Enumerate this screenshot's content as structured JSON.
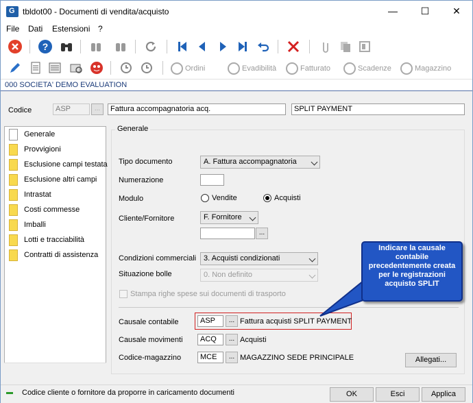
{
  "window": {
    "title": "tbldot00 - Documenti di vendita/acquisto",
    "minimize": "—",
    "maximize": "☐",
    "close": "✕"
  },
  "menu": [
    "File",
    "Dati",
    "Estensioni",
    "?"
  ],
  "toolbar2": {
    "ordini": "Ordini",
    "evadibilita": "Evadibilità",
    "fatturato": "Fatturato",
    "scadenze": "Scadenze",
    "magazzino": "Magazzino"
  },
  "company": "000 SOCIETA' DEMO EVALUATION",
  "header": {
    "codice_label": "Codice",
    "codice": "ASP",
    "descrizione": "Fattura accompagnatoria acq.",
    "descrizione2": "SPLIT PAYMENT",
    "dots": "..."
  },
  "sidebar": {
    "items": [
      "Generale",
      "Provvigioni",
      "Esclusione campi testata",
      "Esclusione altri campi",
      "Intrastat",
      "Costi commesse",
      "Imballi",
      "Lotti e tracciabilità",
      "Contratti di assistenza"
    ]
  },
  "form": {
    "group_title": "Generale",
    "tipo_documento_label": "Tipo documento",
    "tipo_documento": "A. Fattura accompagnatoria",
    "numerazione_label": "Numerazione",
    "numerazione": "",
    "modulo_label": "Modulo",
    "vendite": "Vendite",
    "acquisti": "Acquisti",
    "cliente_fornitore_label": "Cliente/Fornitore",
    "cliente_fornitore": "F. Fornitore",
    "cliente_fornitore_code": "",
    "condizioni_label": "Condizioni commerciali",
    "condizioni": "3. Acquisti condizionati",
    "situazione_label": "Situazione bolle",
    "situazione": "0. Non definito",
    "stampa_label": "Stampa righe spese sui documenti di trasporto",
    "causale_contabile_label": "Causale contabile",
    "causale_contabile_code": "ASP",
    "causale_contabile_desc": "Fattura acquisti SPLIT PAYMENT",
    "causale_movimenti_label": "Causale movimenti",
    "causale_movimenti_code": "ACQ",
    "causale_movimenti_desc": "Acquisti",
    "codice_magazzino_label": "Codice-magazzino",
    "codice_magazzino_code": "MCE",
    "codice_magazzino_desc": "MAGAZZINO SEDE PRINCIPALE",
    "allegati": "Allegati..."
  },
  "callout": "Indicare la causale contabile precedentemente creata per le registrazioni acquisto SPLIT",
  "status": {
    "text": "Codice cliente o fornitore da proporre in caricamento documenti",
    "ok": "OK",
    "esci": "Esci",
    "applica": "Applica"
  }
}
